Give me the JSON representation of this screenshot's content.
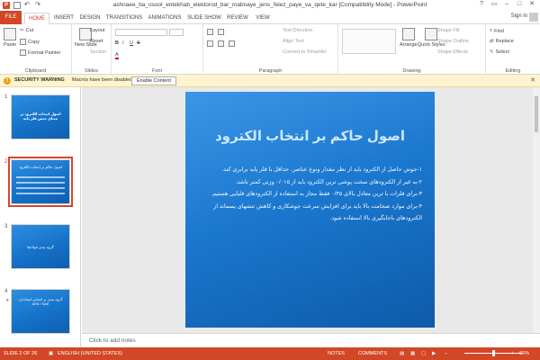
{
  "window": {
    "title": "ashnaee_ba_osool_entekhab_elektorod_bar_mabnaye_jens_felez_paye_va_qete_kar [Compatibility Mode] - PowerPoint",
    "sign_in": "Sign in"
  },
  "tabs": [
    "FILE",
    "HOME",
    "INSERT",
    "DESIGN",
    "TRANSITIONS",
    "ANIMATIONS",
    "SLIDE SHOW",
    "REVIEW",
    "VIEW"
  ],
  "active_tab": "HOME",
  "ribbon": {
    "clipboard": {
      "label": "Clipboard",
      "paste": "Paste",
      "cut": "Cut",
      "copy": "Copy",
      "format_painter": "Format Painter"
    },
    "slides": {
      "label": "Slides",
      "new_slide": "New Slide",
      "layout": "Layout",
      "reset": "Reset",
      "section": "Section"
    },
    "font": {
      "label": "Font"
    },
    "paragraph": {
      "label": "Paragraph",
      "text_direction": "Text Direction",
      "align_text": "Align Text",
      "smartart": "Convert to SmartArt"
    },
    "drawing": {
      "label": "Drawing",
      "arrange": "Arrange",
      "quick_styles": "Quick Styles",
      "shape_fill": "Shape Fill",
      "shape_outline": "Shape Outline",
      "shape_effects": "Shape Effects"
    },
    "editing": {
      "label": "Editing",
      "find": "Find",
      "replace": "Replace",
      "select": "Select"
    }
  },
  "security_bar": {
    "label": "SECURITY WARNING",
    "message": "Macros have been disabled.",
    "button": "Enable Content"
  },
  "thumbnails": [
    {
      "num": "1",
      "text": "اصول انتخاب الکترود بر مبنای جنس فلز پایه"
    },
    {
      "num": "2",
      "text": "اصول حاکم بر انتخاب الکترود"
    },
    {
      "num": "3",
      "text": "گروه بندی فولادها"
    },
    {
      "num": "4",
      "text": "گروه بندی بر اساس استاندارد AISI / SAE"
    }
  ],
  "slide": {
    "title": "اصول حاکم بر انتخاب الکترود",
    "bullets": [
      "۱-جوش حاصل از الکترود باید از نظر مقدار ونوع عناصر، حداقل با فلز پایه برابری کند.",
      "۲-به غیر از الکترودهای سخت پوشی ترین الکترود باید از ۰/۰۱۵ وزنی کمتر باشد.",
      "۳-برای فلزات با ترین معادل بالای ۰/۴۵ فقط مجاز به استفاده از الکترودهای قلیایی هستیم.",
      "۴-برای موارد ضخامت بالا باید برای افزایش سرعت جوشکاری و کاهش تنشهای پسماند از الکترودهای باجابگیری بالا استفاده شود."
    ]
  },
  "notes_placeholder": "Click to add notes",
  "status": {
    "slide_of": "SLIDE 2 OF 26",
    "language": "ENGLISH (UNITED STATES)",
    "notes": "NOTES",
    "comments": "COMMENTS",
    "zoom": "66%"
  },
  "colors": {
    "accent": "#d24726",
    "slide_blue": "#1b78cf",
    "warning_bg": "#fff4ce"
  }
}
